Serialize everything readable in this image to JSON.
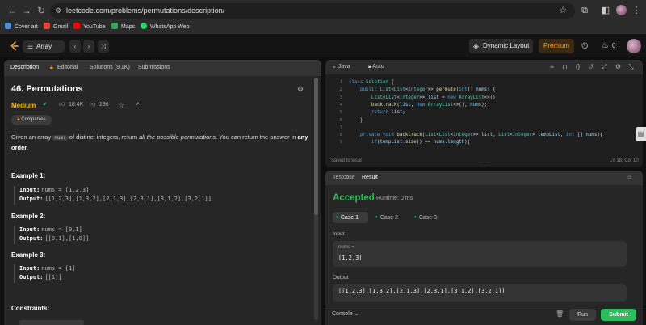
{
  "browser": {
    "url": "leetcode.com/problems/permutations/description/",
    "bookmarks": [
      "Cover art",
      "Gmail",
      "YouTube",
      "Maps",
      "WhatsApp Web"
    ]
  },
  "header": {
    "problem_list_label": "Array",
    "dynamic_layout_label": "Dynamic Layout",
    "premium_label": "Premium",
    "streak_count": "0"
  },
  "description_panel": {
    "tabs": [
      "Description",
      "Editorial",
      "Solutions (9.1K)",
      "Submissions"
    ],
    "title": "46. Permutations",
    "difficulty": "Medium",
    "likes": "18.4K",
    "dislikes": "296",
    "companies_label": "Companies",
    "statement": {
      "part1": "Given an array ",
      "code": "nums",
      "part2": " of distinct integers, return ",
      "italic": "all the possible permutations",
      "part3": ". You can return the answer in ",
      "bold": "any order",
      "part4": "."
    },
    "examples": [
      {
        "heading": "Example 1:",
        "input_label": "Input:",
        "input": "nums = [1,2,3]",
        "output_label": "Output:",
        "output": "[[1,2,3],[1,3,2],[2,1,3],[2,3,1],[3,1,2],[3,2,1]]"
      },
      {
        "heading": "Example 2:",
        "input_label": "Input:",
        "input": "nums = [0,1]",
        "output_label": "Output:",
        "output": "[[0,1],[1,0]]"
      },
      {
        "heading": "Example 3:",
        "input_label": "Input:",
        "input": "nums = [1]",
        "output_label": "Output:",
        "output": "[[1]]"
      }
    ],
    "constraints_heading": "Constraints:"
  },
  "code_panel": {
    "language": "Java",
    "mode": "Auto",
    "saved_status": "Saved to local",
    "cursor_position": "Ln 18, Col 10",
    "line_numbers": [
      "1",
      "2",
      "3",
      "4",
      "5",
      "6",
      "7",
      "8",
      "9"
    ]
  },
  "test_panel": {
    "tabs": [
      "Testcase",
      "Result"
    ],
    "status": "Accepted",
    "runtime": "Runtime: 0 ms",
    "cases": [
      "Case 1",
      "Case 2",
      "Case 3"
    ],
    "input_label": "Input",
    "input_var": "nums =",
    "input_value": "[1,2,3]",
    "output_label": "Output",
    "output_value": "[[1,2,3],[1,3,2],[2,1,3],[2,3,1],[3,1,2],[3,2,1]]",
    "console_label": "Console",
    "run_label": "Run",
    "submit_label": "Submit"
  },
  "colors": {
    "accent_green": "#2cbb5d",
    "difficulty_medium": "#ffb800",
    "premium_orange": "#ffa116"
  }
}
